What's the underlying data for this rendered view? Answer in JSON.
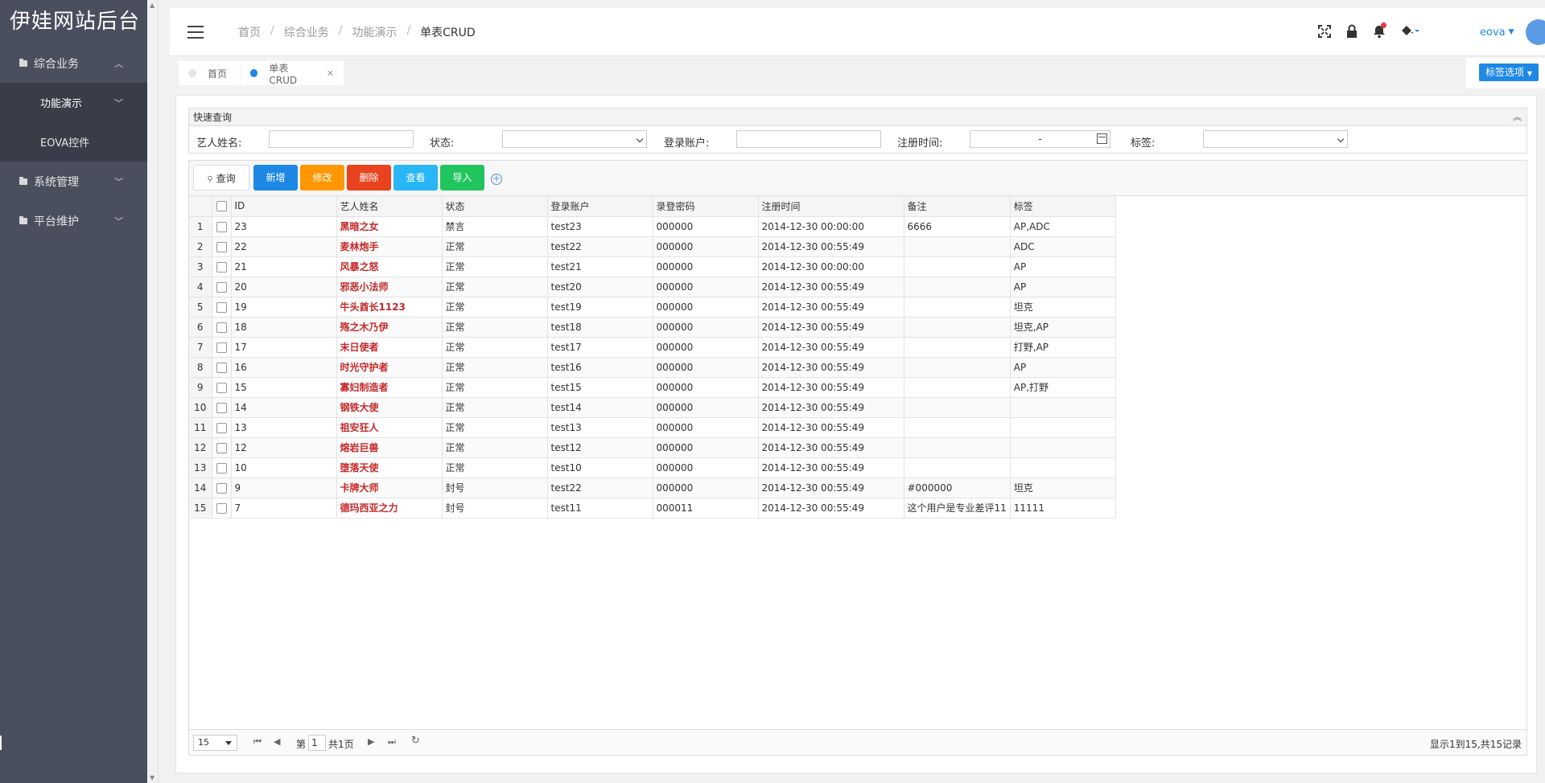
{
  "app": {
    "title": "伊娃网站后台"
  },
  "sidebar": {
    "items": [
      {
        "label": "综合业务",
        "expanded": true,
        "sub": [
          {
            "label": "功能演示"
          },
          {
            "label": "EOVA控件"
          }
        ]
      },
      {
        "label": "系统管理"
      },
      {
        "label": "平台维护"
      }
    ]
  },
  "header": {
    "breadcrumb": [
      "首页",
      "综合业务",
      "功能演示",
      "单表CRUD"
    ],
    "user": "eova"
  },
  "tabs": [
    {
      "label": "首页",
      "active": false
    },
    {
      "label": "单表CRUD",
      "active": true
    }
  ],
  "tab_options_label": "标签选项",
  "query": {
    "title": "快速查询",
    "fields": {
      "name_label": "艺人姓名:",
      "status_label": "状态:",
      "account_label": "登录账户:",
      "regtime_label": "注册时间:",
      "regtime_sep": "-",
      "tag_label": "标签:"
    }
  },
  "toolbar": {
    "query": "查询",
    "add": "新增",
    "edit": "修改",
    "delete": "删除",
    "view": "查看",
    "import": "导入"
  },
  "table": {
    "columns": [
      "ID",
      "艺人姓名",
      "状态",
      "登录账户",
      "录登密码",
      "注册时间",
      "备注",
      "标签"
    ],
    "rows": [
      [
        "1",
        "23",
        "黑暗之女",
        "禁言",
        "test23",
        "000000",
        "2014-12-30 00:00:00",
        "6666",
        "AP,ADC"
      ],
      [
        "2",
        "22",
        "麦林炮手",
        "正常",
        "test22",
        "000000",
        "2014-12-30 00:55:49",
        "",
        "ADC"
      ],
      [
        "3",
        "21",
        "风暴之怒",
        "正常",
        "test21",
        "000000",
        "2014-12-30 00:00:00",
        "",
        "AP"
      ],
      [
        "4",
        "20",
        "邪恶小法师",
        "正常",
        "test20",
        "000000",
        "2014-12-30 00:55:49",
        "",
        "AP"
      ],
      [
        "5",
        "19",
        "牛头酋长1123",
        "正常",
        "test19",
        "000000",
        "2014-12-30 00:55:49",
        "",
        "坦克"
      ],
      [
        "6",
        "18",
        "殇之木乃伊",
        "正常",
        "test18",
        "000000",
        "2014-12-30 00:55:49",
        "",
        "坦克,AP"
      ],
      [
        "7",
        "17",
        "末日使者",
        "正常",
        "test17",
        "000000",
        "2014-12-30 00:55:49",
        "",
        "打野,AP"
      ],
      [
        "8",
        "16",
        "时光守护者",
        "正常",
        "test16",
        "000000",
        "2014-12-30 00:55:49",
        "",
        "AP"
      ],
      [
        "9",
        "15",
        "寡妇制造者",
        "正常",
        "test15",
        "000000",
        "2014-12-30 00:55:49",
        "",
        "AP,打野"
      ],
      [
        "10",
        "14",
        "钢铁大使",
        "正常",
        "test14",
        "000000",
        "2014-12-30 00:55:49",
        "",
        ""
      ],
      [
        "11",
        "13",
        "祖安狂人",
        "正常",
        "test13",
        "000000",
        "2014-12-30 00:55:49",
        "",
        ""
      ],
      [
        "12",
        "12",
        "熔岩巨兽",
        "正常",
        "test12",
        "000000",
        "2014-12-30 00:55:49",
        "",
        ""
      ],
      [
        "13",
        "10",
        "堕落天使",
        "正常",
        "test10",
        "000000",
        "2014-12-30 00:55:49",
        "",
        ""
      ],
      [
        "14",
        "9",
        "卡牌大师",
        "封号",
        "test22",
        "000000",
        "2014-12-30 00:55:49",
        "#000000",
        "坦克"
      ],
      [
        "15",
        "7",
        "德玛西亚之力",
        "封号",
        "test11",
        "000011",
        "2014-12-30 00:55:49",
        "这个用户是专业差评11",
        "11111"
      ]
    ]
  },
  "pager": {
    "page_size": "15",
    "page_prefix": "第",
    "page": "1",
    "total_pages": "共1页",
    "info": "显示1到15,共15记录"
  },
  "colors": {
    "sidebar": "#4a4f5e",
    "primary": "#1e88e5",
    "warning": "#ff9800",
    "danger": "#e8431e",
    "info": "#29b6f6",
    "success": "#21c55d",
    "name_text": "#c62828"
  }
}
